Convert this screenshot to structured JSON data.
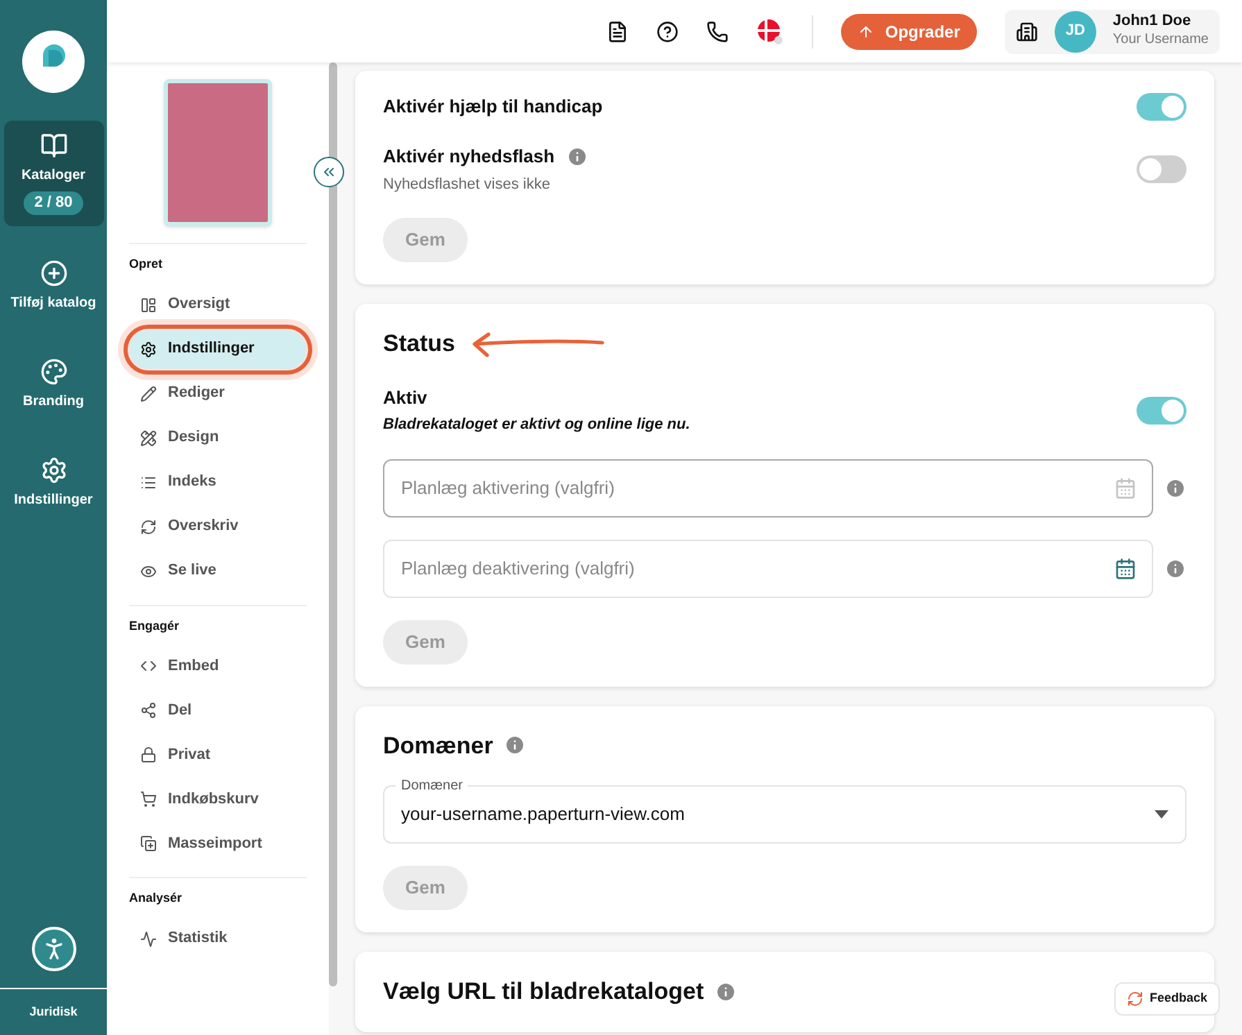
{
  "rail": {
    "items": [
      {
        "label": "Kataloger",
        "badge": "2 / 80",
        "selected": true
      },
      {
        "label": "Tilføj katalog",
        "selected": false
      },
      {
        "label": "Branding",
        "selected": false
      },
      {
        "label": "Indstillinger",
        "selected": false
      }
    ],
    "footer": "Juridisk"
  },
  "sidebar": {
    "sections": [
      {
        "title": "Opret",
        "items": [
          {
            "label": "Oversigt",
            "selected": false,
            "highlighted": false
          },
          {
            "label": "Indstillinger",
            "selected": true,
            "highlighted": true
          },
          {
            "label": "Rediger",
            "selected": false,
            "highlighted": false
          },
          {
            "label": "Design",
            "selected": false,
            "highlighted": false
          },
          {
            "label": "Indeks",
            "selected": false,
            "highlighted": false
          },
          {
            "label": "Overskriv",
            "selected": false,
            "highlighted": false
          },
          {
            "label": "Se live",
            "selected": false,
            "highlighted": false
          }
        ]
      },
      {
        "title": "Engagér",
        "items": [
          {
            "label": "Embed",
            "selected": false,
            "highlighted": false
          },
          {
            "label": "Del",
            "selected": false,
            "highlighted": false
          },
          {
            "label": "Privat",
            "selected": false,
            "highlighted": false
          },
          {
            "label": "Indkøbskurv",
            "selected": false,
            "highlighted": false
          },
          {
            "label": "Masseimport",
            "selected": false,
            "highlighted": false
          }
        ]
      },
      {
        "title": "Analysér",
        "items": [
          {
            "label": "Statistik",
            "selected": false,
            "highlighted": false
          }
        ]
      }
    ]
  },
  "header": {
    "upgrade": "Opgrader",
    "user": {
      "initials": "JD",
      "name": "John1 Doe",
      "username": "Your Username"
    }
  },
  "cards": [
    {
      "kind": "toggles",
      "rows": [
        {
          "label": "Aktivér hjælp til handicap",
          "on": true
        },
        {
          "label": "Aktivér nyhedsflash",
          "info": true,
          "hint": "Nyhedsflashet vises ikke",
          "on": false
        }
      ],
      "save": {
        "label": "Gem",
        "disabled": true
      }
    },
    {
      "kind": "status",
      "title": "Status",
      "annotated": true,
      "rows": [
        {
          "label": "Aktiv",
          "hint": "Bladrekataloget er aktivt og online lige nu.",
          "on": true
        }
      ],
      "fields": [
        {
          "placeholder": "Planlæg aktivering (valgfri)",
          "focused": true
        },
        {
          "placeholder": "Planlæg deaktivering (valgfri)",
          "focused": false
        }
      ],
      "save": {
        "label": "Gem",
        "disabled": true
      }
    },
    {
      "kind": "select",
      "title": "Domæner",
      "info": true,
      "select": {
        "label": "Domæner",
        "value": "your-username.paperturn-view.com"
      },
      "save": {
        "label": "Gem",
        "disabled": true
      }
    },
    {
      "kind": "heading",
      "title": "Vælg URL til bladrekataloget",
      "info": true
    }
  ],
  "feedback": "Feedback"
}
